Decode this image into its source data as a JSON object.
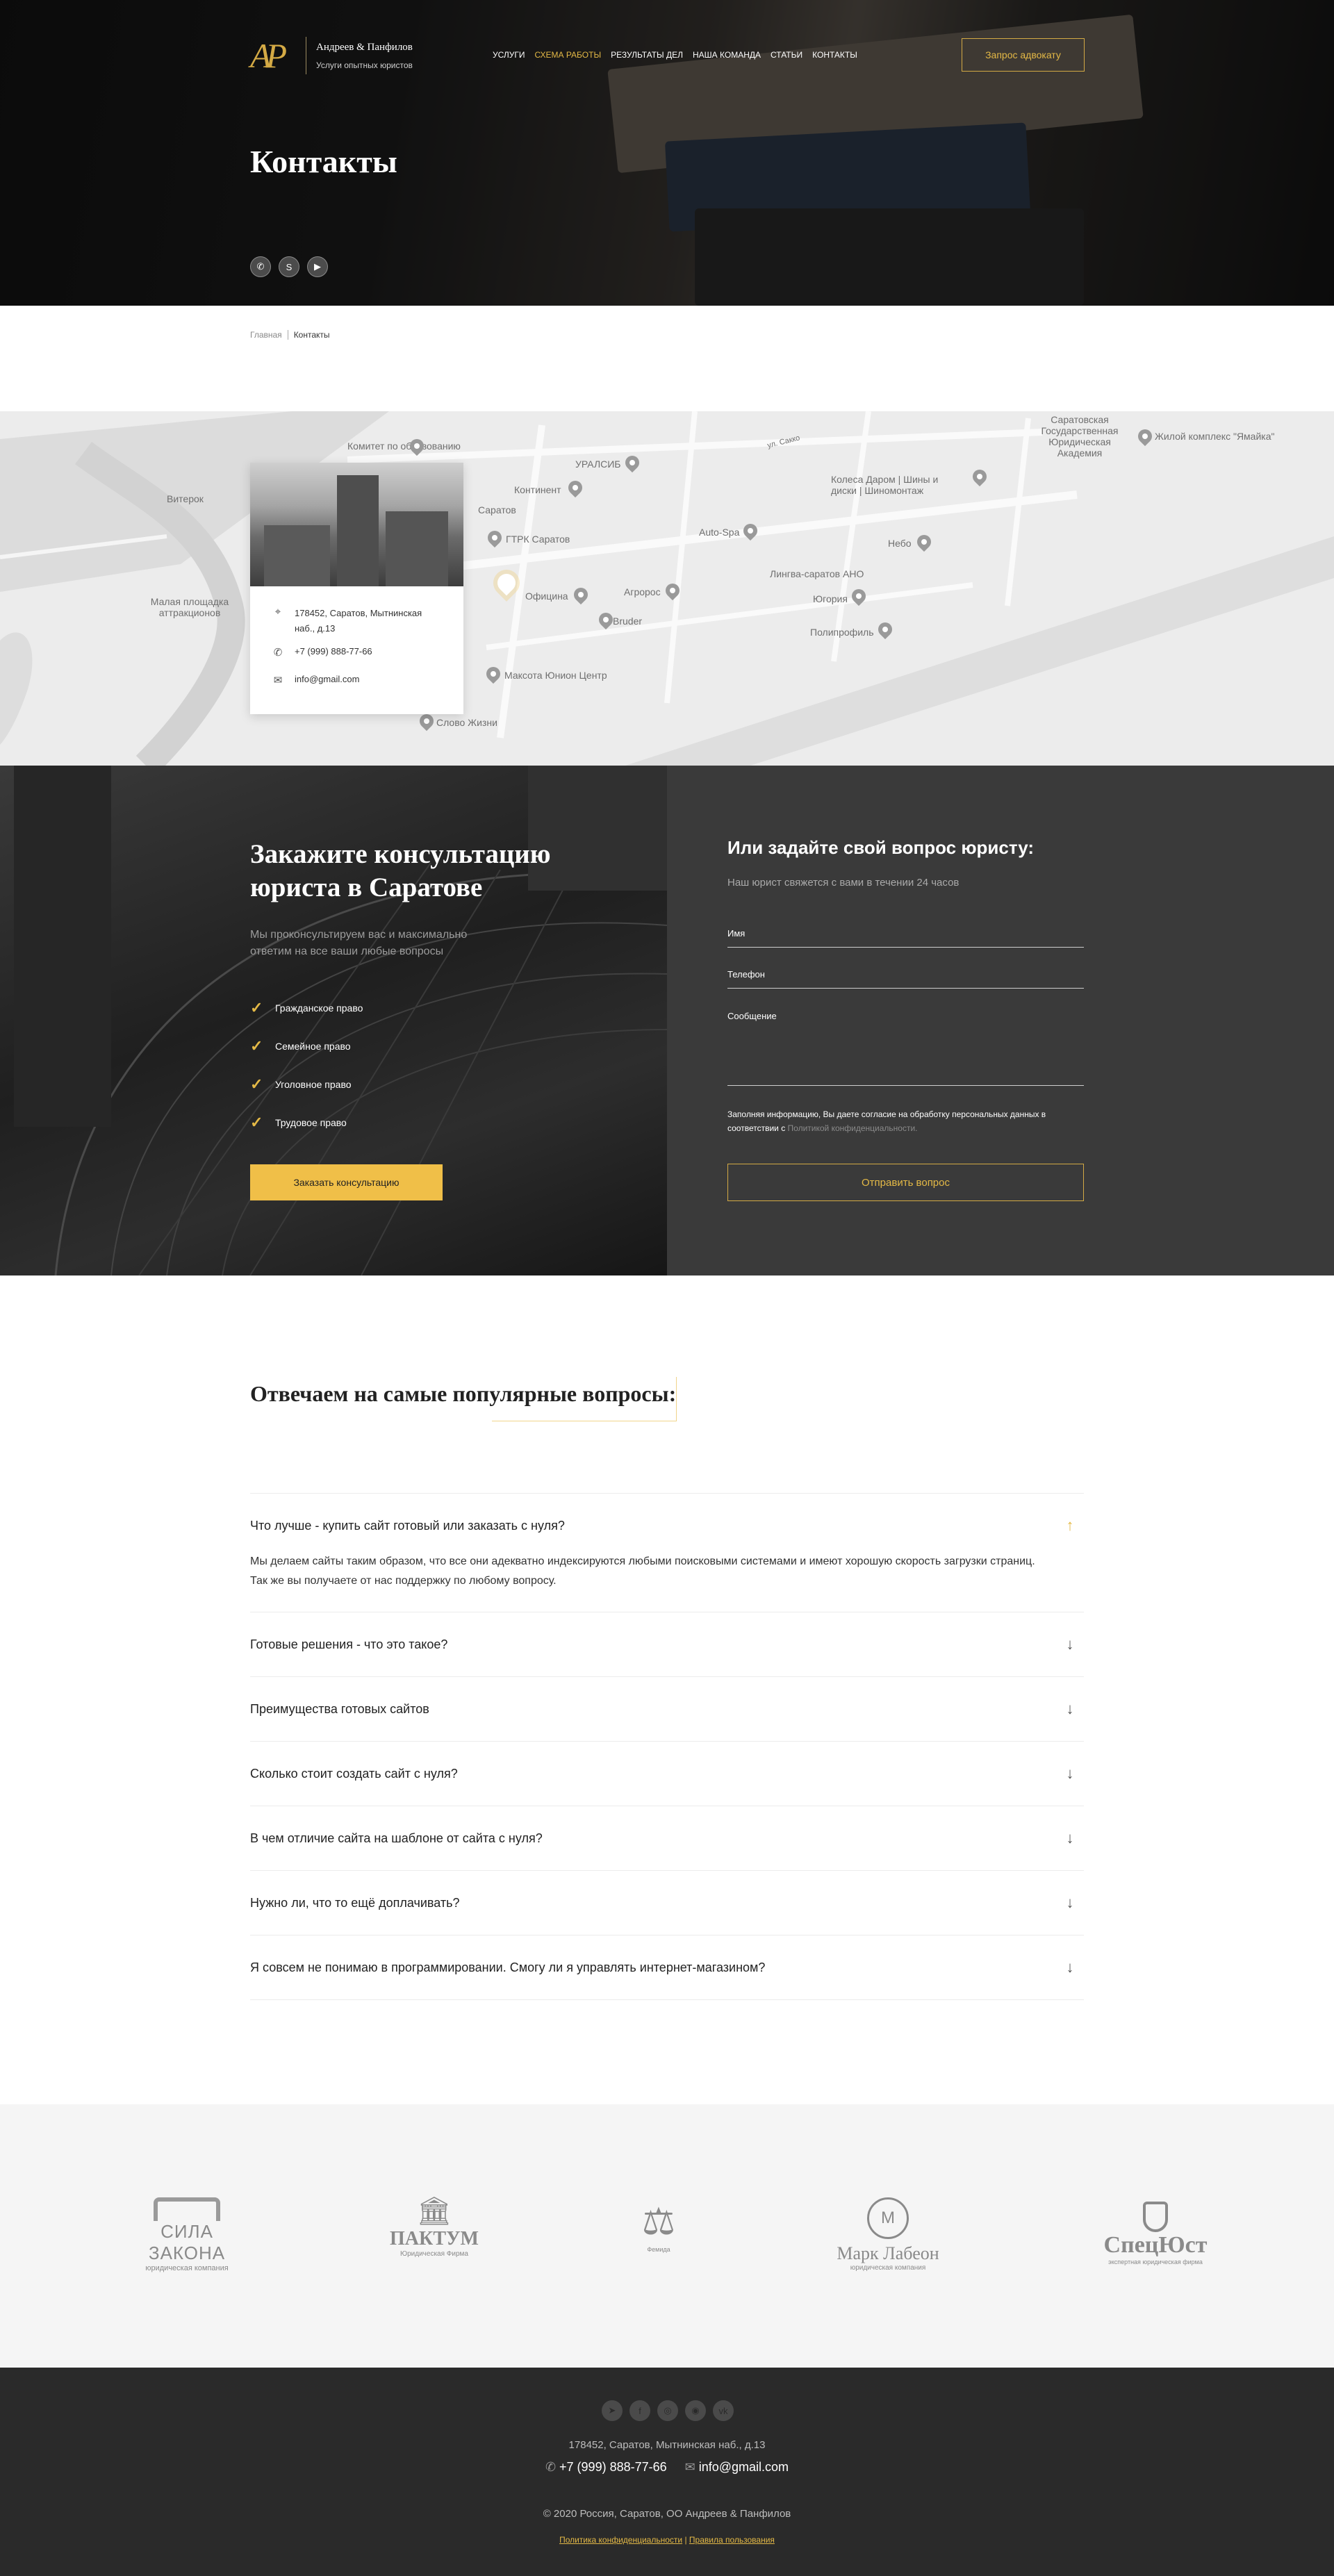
{
  "header": {
    "logo_mark": "AP",
    "brand_name": "Андреев & Панфилов",
    "brand_tagline": "Услуги опытных юристов",
    "nav": [
      {
        "label": "Услуги",
        "active": false
      },
      {
        "label": "Схема работы",
        "active": true
      },
      {
        "label": "Результаты дел",
        "active": false
      },
      {
        "label": "Наша команда",
        "active": false
      },
      {
        "label": "Статьи",
        "active": false
      },
      {
        "label": "Контакты",
        "active": false
      }
    ],
    "cta_label": "Запрос адвокату",
    "page_title": "Контакты",
    "socials": [
      "whatsapp-icon",
      "skype-icon",
      "youtube-icon"
    ]
  },
  "breadcrumb": {
    "home": "Главная",
    "current": "Контакты"
  },
  "map": {
    "labels": [
      "Комитет по образованию",
      "УРАЛСИБ",
      "ул. Сакко",
      "Саратовская Государственная Юридическая Академия",
      "Жилой комплекс \"Ямайка\"",
      "Континент",
      "Колеса Даром | Шины и диски | Шиномонтаж",
      "Витерок",
      "Саратов",
      "ГТРК Саратов",
      "Auto-Spa",
      "Небо",
      "Лингва-саратов АНО",
      "Официна",
      "Агророс",
      "Югория",
      "Малая площадка аттракционов",
      "Bruder",
      "Полипрофиль",
      "Максота Юнион Центр",
      "Слово Жизни"
    ],
    "card": {
      "address": "178452, Саратов, Мытнинская наб., д.13",
      "phone": "+7 (999) 888-77-66",
      "email": "info@gmail.com"
    }
  },
  "consult": {
    "title": "Закажите консультацию юриста в Саратове",
    "subtitle": "Мы проконсультируем вас и максимально ответим на все ваши любые вопросы",
    "items": [
      "Гражданское право",
      "Семейное право",
      "Уголовное право",
      "Трудовое право"
    ],
    "button": "Заказать консультацию"
  },
  "question_form": {
    "title": "Или задайте свой вопрос юристу:",
    "subtitle": "Наш юрист свяжется с вами в течении 24 часов",
    "name_label": "Имя",
    "phone_label": "Телефон",
    "message_label": "Сообщение",
    "consent_text": "Заполняя информацию, Вы даете согласие на обработку персональных данных в соответствии с",
    "consent_link": "Политикой конфиденциальности.",
    "submit": "Отправить вопрос"
  },
  "faq": {
    "title": "Отвечаем на самые популярные вопросы:",
    "items": [
      {
        "q": "Что лучше - купить сайт готовый или заказать с нуля?",
        "a": "Мы делаем сайты таким образом, что все они адекватно индексируются любыми поисковыми системами и имеют хорошую скорость загрузки страниц. Так же вы получаете от нас поддержку по любому вопросу.",
        "open": true
      },
      {
        "q": "Готовые решения - что это такое?",
        "a": "",
        "open": false
      },
      {
        "q": "Преимущества готовых сайтов",
        "a": "",
        "open": false
      },
      {
        "q": "Сколько стоит создать сайт с нуля?",
        "a": "",
        "open": false
      },
      {
        "q": "В чем отличие сайта на шаблоне от сайта с нуля?",
        "a": "",
        "open": false
      },
      {
        "q": "Нужно ли, что то ещё доплачивать?",
        "a": "",
        "open": false
      },
      {
        "q": "Я совсем не понимаю в программировании. Смогу ли я управлять интернет-магазином?",
        "a": "",
        "open": false
      }
    ]
  },
  "partners": [
    {
      "name": "СИЛА ЗАКОНА",
      "sub": "юридическая компания"
    },
    {
      "name": "ПАКТУМ",
      "sub": "Юридическая Фирма"
    },
    {
      "name": "Фемида",
      "sub": ""
    },
    {
      "name": "Марк Лабеон",
      "sub": "юридическая компания"
    },
    {
      "name": "СпецЮст",
      "sub": "экспертная юридическая фирма"
    }
  ],
  "footer": {
    "socials": [
      "telegram-icon",
      "facebook-icon",
      "instagram-icon",
      "instagram-icon",
      "vk-icon"
    ],
    "address": "178452, Саратов, Мытнинская наб., д.13",
    "phone": "+7 (999) 888-77-66",
    "email": "info@gmail.com",
    "copyright": "© 2020 Россия, Саратов, ОО Андреев & Панфилов",
    "privacy": "Политика конфиденциальности",
    "sep": "|",
    "terms": "Правила пользования"
  },
  "colors": {
    "gold": "#E4B946",
    "dark": "#2A2A2A",
    "form_bg": "#3A3A3A"
  }
}
